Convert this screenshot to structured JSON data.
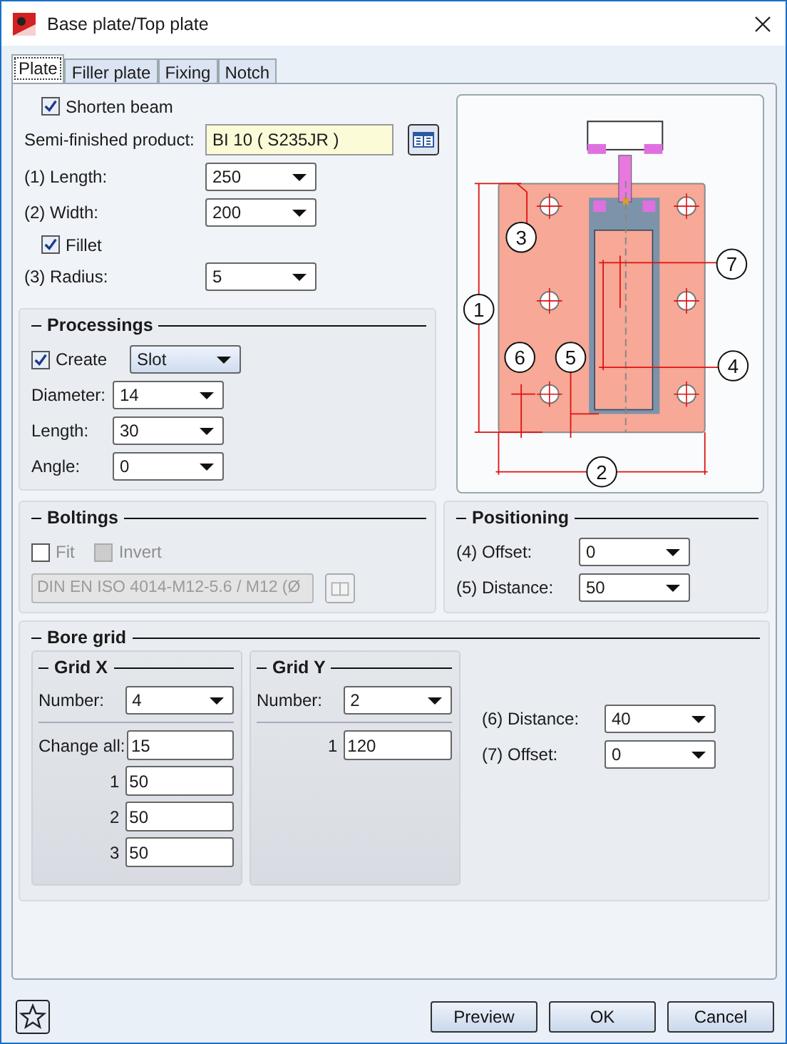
{
  "window": {
    "title": "Base plate/Top plate"
  },
  "tabs": [
    {
      "label": "Plate",
      "selected": true
    },
    {
      "label": "Filler plate",
      "selected": false
    },
    {
      "label": "Fixing",
      "selected": false
    },
    {
      "label": "Notch",
      "selected": false
    }
  ],
  "plate": {
    "shorten_beam": {
      "label": "Shorten beam",
      "checked": true
    },
    "semi_finished": {
      "label": "Semi-finished product:",
      "value": "BI 10  ( S235JR )"
    },
    "length": {
      "label": "(1) Length:",
      "value": "250"
    },
    "width": {
      "label": "(2) Width:",
      "value": "200"
    },
    "fillet": {
      "label": "Fillet",
      "checked": true
    },
    "radius": {
      "label": "(3) Radius:",
      "value": "5"
    }
  },
  "diagram": {
    "callouts": [
      "3",
      "7",
      "1",
      "6",
      "5",
      "4",
      "2"
    ]
  },
  "processings": {
    "title": "Processings",
    "create": {
      "label": "Create",
      "checked": true,
      "value": "Slot"
    },
    "fields": [
      {
        "label": "Diameter:",
        "value": "14"
      },
      {
        "label": "Length:",
        "value": "30"
      },
      {
        "label": "Angle:",
        "value": "0"
      }
    ]
  },
  "boltings": {
    "title": "Boltings",
    "disabled": true,
    "fit": {
      "label": "Fit",
      "checked": false
    },
    "invert": {
      "label": "Invert",
      "checked": false
    },
    "bolt": "DIN EN ISO 4014-M12-5.6 / M12 (Ø"
  },
  "positioning": {
    "title": "Positioning",
    "fields": [
      {
        "label": "(4) Offset:",
        "value": "0"
      },
      {
        "label": "(5) Distance:",
        "value": "50"
      }
    ]
  },
  "bore_grid": {
    "title": "Bore grid",
    "grid_x": {
      "title": "Grid X",
      "number": {
        "label": "Number:",
        "value": "4"
      },
      "rows": [
        {
          "label": "Change all:",
          "value": "15"
        },
        {
          "label": "1",
          "value": "50"
        },
        {
          "label": "2",
          "value": "50"
        },
        {
          "label": "3",
          "value": "50"
        }
      ]
    },
    "grid_y": {
      "title": "Grid Y",
      "number": {
        "label": "Number:",
        "value": "2"
      },
      "rows": [
        {
          "label": "1",
          "value": "120"
        }
      ]
    },
    "fields": [
      {
        "label": "(6) Distance:",
        "value": "40"
      },
      {
        "label": "(7) Offset:",
        "value": "0"
      }
    ]
  },
  "buttons": [
    {
      "label": "Preview"
    },
    {
      "label": "OK"
    },
    {
      "label": "Cancel"
    }
  ]
}
